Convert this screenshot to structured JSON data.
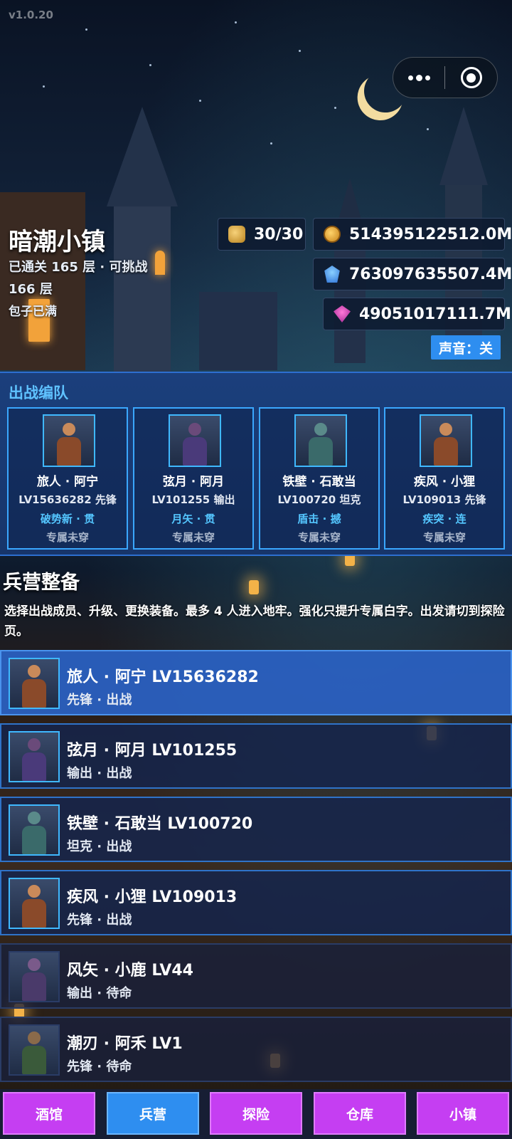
{
  "app": {
    "version": "v1.0.20"
  },
  "town": {
    "name": "暗潮小镇",
    "progress": "已通关 165 层 · 可挑战 166 层",
    "bag_status": "包子已满"
  },
  "resources": {
    "stamina": "30/30",
    "gold": "514395122512.0M",
    "crystal": "763097635507.4M",
    "gem": "49051017111.7M"
  },
  "sound_toggle": "声音：关",
  "squad": {
    "title": "出战编队",
    "members": [
      {
        "name": "旅人 · 阿宁",
        "level_role": "LV15636282 先锋",
        "skill": "破势新 · 贯",
        "gear": "专属未穿"
      },
      {
        "name": "弦月 · 阿月",
        "level_role": "LV101255 输出",
        "skill": "月矢 · 贯",
        "gear": "专属未穿"
      },
      {
        "name": "铁壁 · 石敢当",
        "level_role": "LV100720 坦克",
        "skill": "盾击 · 撼",
        "gear": "专属未穿"
      },
      {
        "name": "疾风 · 小狸",
        "level_role": "LV109013 先锋",
        "skill": "疾突 · 连",
        "gear": "专属未穿"
      }
    ]
  },
  "barracks": {
    "title": "兵营整备",
    "description": "选择出战成员、升级、更换装备。最多 4 人进入地牢。强化只提升专属白字。出发请切到探险页。",
    "members": [
      {
        "title": "旅人 · 阿宁  LV15636282",
        "sub": "先锋 · 出战"
      },
      {
        "title": "弦月 · 阿月  LV101255",
        "sub": "输出 · 出战"
      },
      {
        "title": "铁壁 · 石敢当  LV100720",
        "sub": "坦克 · 出战"
      },
      {
        "title": "疾风 · 小狸  LV109013",
        "sub": "先锋 · 出战"
      },
      {
        "title": "风矢 · 小鹿  LV44",
        "sub": "输出 · 待命"
      },
      {
        "title": "潮刃 · 阿禾  LV1",
        "sub": "先锋 · 待命"
      }
    ]
  },
  "nav": {
    "tavern": "酒馆",
    "barracks": "兵营",
    "explore": "探险",
    "warehouse": "仓库",
    "town": "小镇"
  },
  "colors": {
    "accent_blue": "#2e8ef0",
    "nav_purple": "#c53ef2",
    "squad_panel": "#1b3f7c",
    "skill_cyan": "#54c6ff"
  },
  "icons": {
    "stamina": "bread-basket-icon",
    "gold": "gold-coin-icon",
    "crystal": "blue-crystal-icon",
    "gem": "purple-gem-icon",
    "menu": "more-dots-icon",
    "close": "target-circle-icon"
  }
}
